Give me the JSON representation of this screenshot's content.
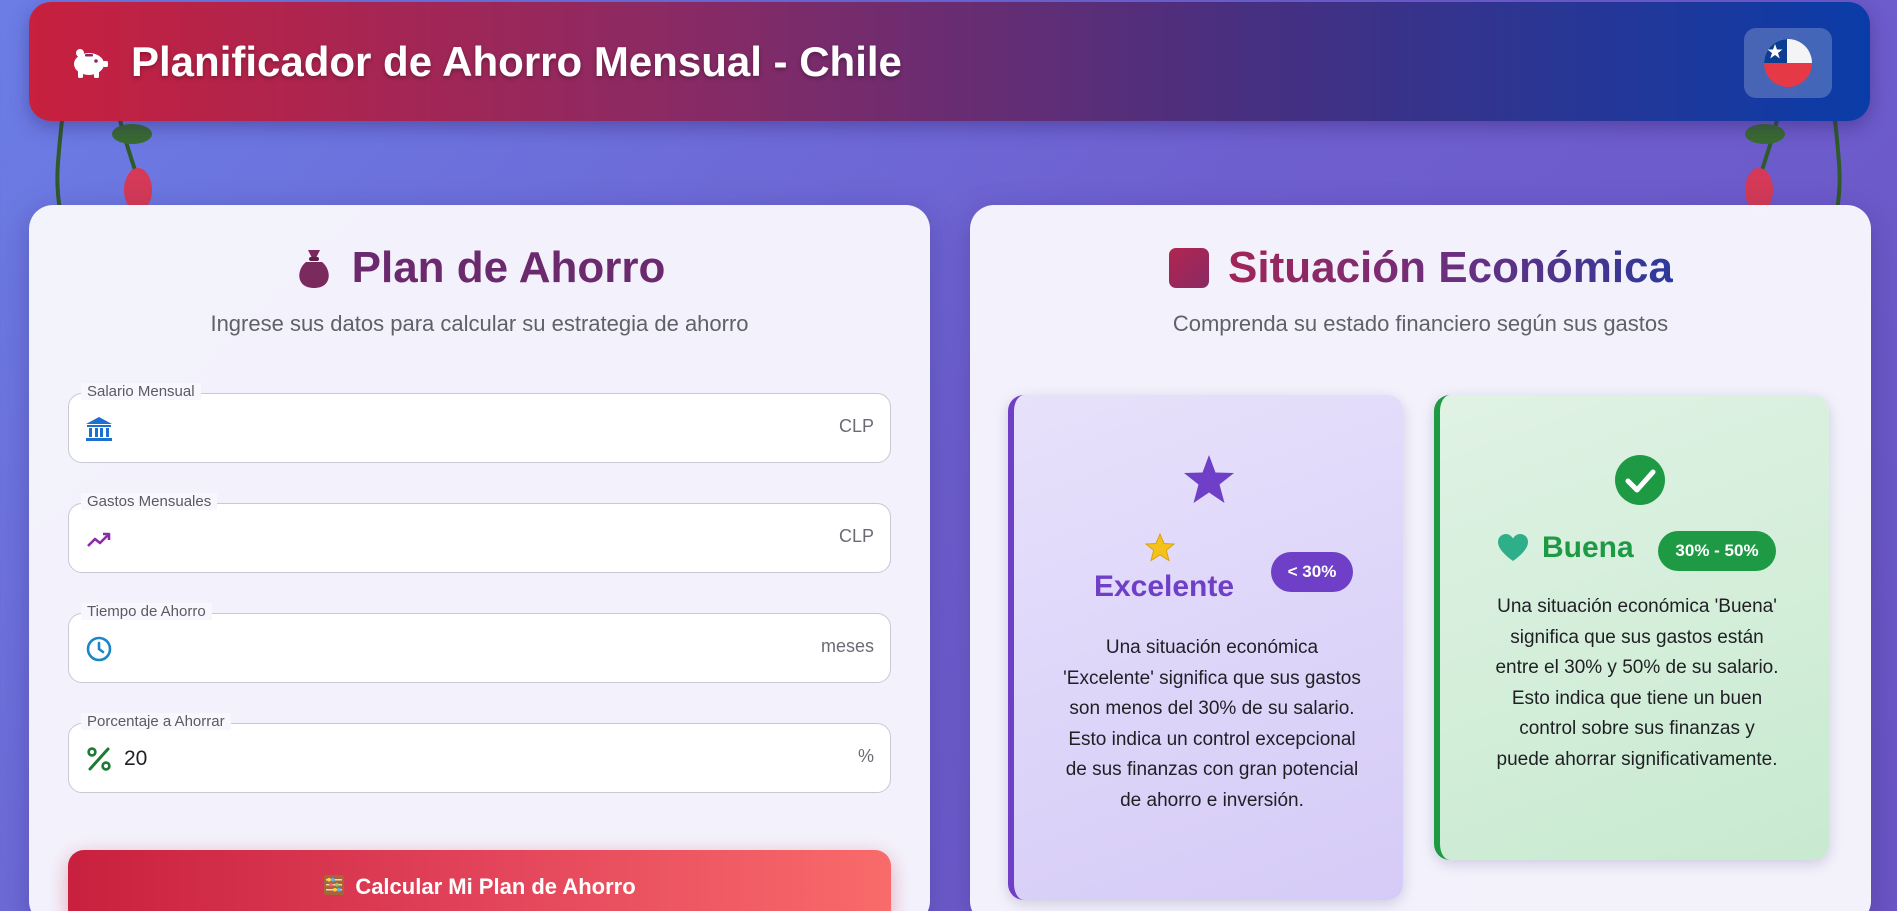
{
  "header": {
    "title": "Planificador de Ahorro Mensual - Chile",
    "piggy_icon": "piggy-bank-icon",
    "flag_icon": "chile-flag-icon"
  },
  "plan_panel": {
    "title": "Plan de Ahorro",
    "title_icon": "money-bag-icon",
    "subtitle": "Ingrese sus datos para calcular su estrategia de ahorro",
    "fields": [
      {
        "label": "Salario Mensual",
        "icon": "bank-icon",
        "value": "",
        "unit": "CLP"
      },
      {
        "label": "Gastos Mensuales",
        "icon": "trending-up-icon",
        "value": "",
        "unit": "CLP"
      },
      {
        "label": "Tiempo de Ahorro",
        "icon": "clock-icon",
        "value": "",
        "unit": "meses"
      },
      {
        "label": "Porcentaje a Ahorrar",
        "icon": "percent-icon",
        "value": "20",
        "unit": "%"
      }
    ],
    "calculate_button": {
      "label": "Calcular Mi Plan de Ahorro",
      "icon": "abacus-icon"
    }
  },
  "situation_panel": {
    "title": "Situación Económica",
    "title_icon": "square-icon",
    "subtitle": "Comprenda su estado financiero según sus gastos",
    "cards": [
      {
        "heading": "Excelente",
        "badge": "< 30%",
        "icon": "star-icon",
        "description": "Una situación económica 'Excelente' significa que sus gastos son menos del 30% de su salario. Esto indica un control excepcional de sus finanzas con gran potencial de ahorro e inversión."
      },
      {
        "heading": "Buena",
        "badge": "30% - 50%",
        "icon": "check-circle-icon",
        "description": "Una situación económica 'Buena' significa que sus gastos están entre el 30% y 50% de su salario. Esto indica que tiene un buen control sobre sus finanzas y puede ahorrar significativamente."
      }
    ]
  },
  "colors": {
    "header_start": "#c8203e",
    "header_end": "#0a3ca8",
    "excellent": "#6f3fc7",
    "good": "#1e9a45",
    "button_start": "#c8203e",
    "button_end": "#f96b6b"
  }
}
